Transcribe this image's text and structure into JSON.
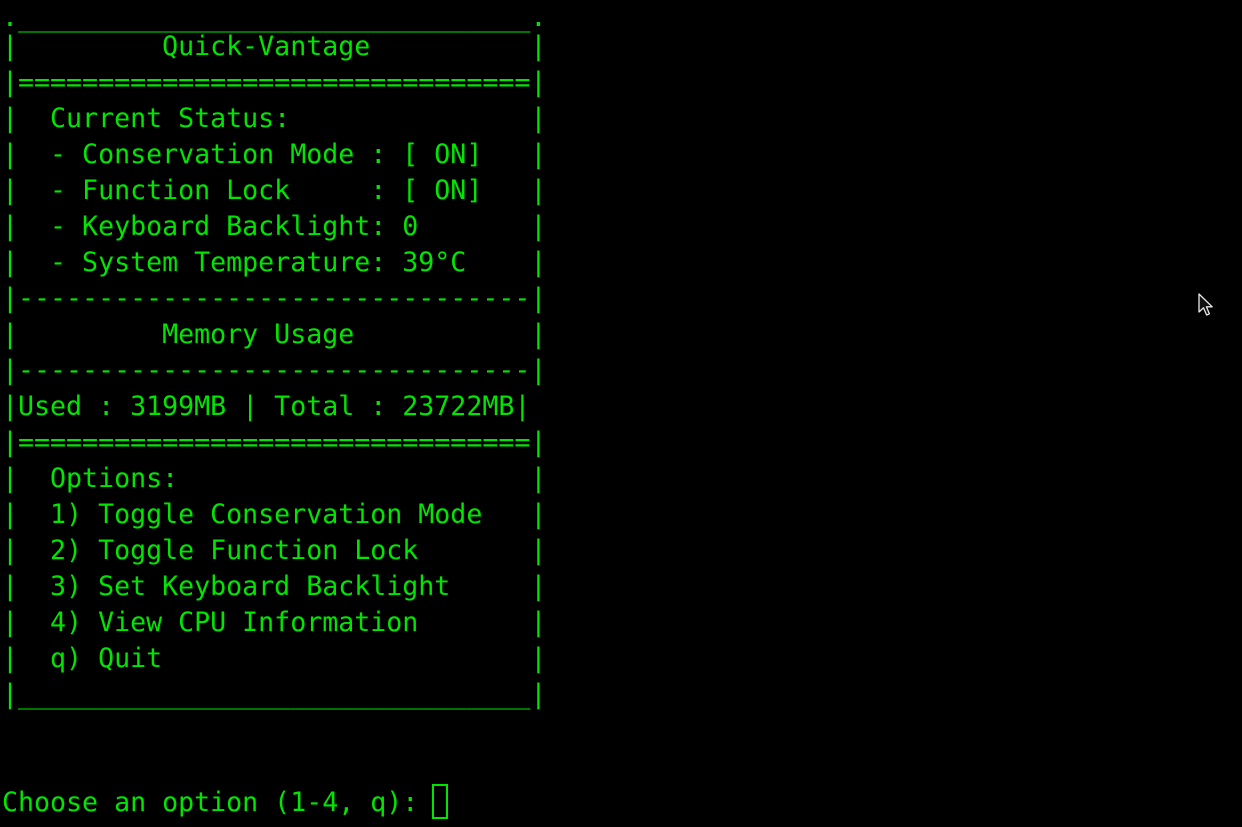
{
  "colors": {
    "background": "#000000",
    "foreground": "#00e600"
  },
  "panel": {
    "top_border": ".________________________________.",
    "title_row": "|         Quick-Vantage          |",
    "double_rule_1": "|================================|",
    "status_header": "|  Current Status:               |",
    "status_rows": [
      "|  - Conservation Mode : [ ON]   |",
      "|  - Function Lock     : [ ON]   |",
      "|  - Keyboard Backlight: 0       |",
      "|  - System Temperature: 39°C    |"
    ],
    "rule_1": "|--------------------------------|",
    "memory_title_row": "|         Memory Usage           |",
    "rule_2": "|--------------------------------|",
    "memory_row": "|Used : 3199MB | Total : 23722MB|",
    "double_rule_2": "|================================|",
    "options_header": "|  Options:                      |",
    "option_rows": [
      "|  1) Toggle Conservation Mode   |",
      "|  2) Toggle Function Lock       |",
      "|  3) Set Keyboard Backlight     |",
      "|  4) View CPU Information       |",
      "|  q) Quit                       |"
    ],
    "bottom_border": "|________________________________|"
  },
  "prompt": {
    "text": "Choose an option (1-4, q): "
  },
  "icons": {
    "mouse_pointer": "arrow-cursor-icon",
    "text_cursor": "block-cursor-icon"
  }
}
